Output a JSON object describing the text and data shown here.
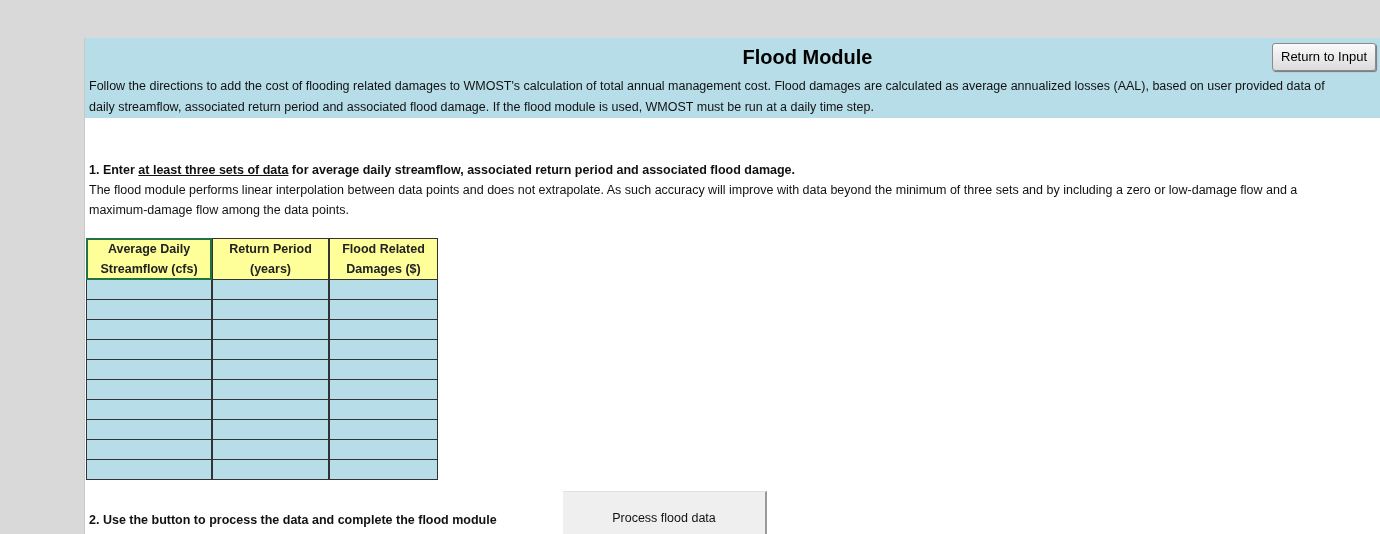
{
  "header": {
    "title": "Flood Module",
    "return_button": "Return to Input",
    "description": "Follow the directions to add the cost of flooding related damages to WMOST's calculation of total annual management cost. Flood damages are calculated as average annualized losses (AAL), based on user provided data of daily streamflow, associated return period and associated flood damage. If the flood module is used, WMOST must be run at a daily time step."
  },
  "step1": {
    "before": "1. Enter ",
    "underlined": "at least three sets of data",
    "after": " for average daily streamflow, associated return period and associated flood damage.",
    "note": "The flood module performs linear interpolation between data points and does not extrapolate. As such accuracy will improve with data beyond the minimum of three sets and by including a zero or low-damage flow and a maximum-damage flow among the data points."
  },
  "table": {
    "columns": [
      {
        "label": "Average Daily Streamflow (cfs)",
        "selected": true
      },
      {
        "label": "Return Period (years)",
        "selected": false
      },
      {
        "label": "Flood Related Damages ($)",
        "selected": false
      }
    ]
  },
  "step2": {
    "text": "2. Use the button to process the data and complete the flood module",
    "button": "Process flood data"
  }
}
